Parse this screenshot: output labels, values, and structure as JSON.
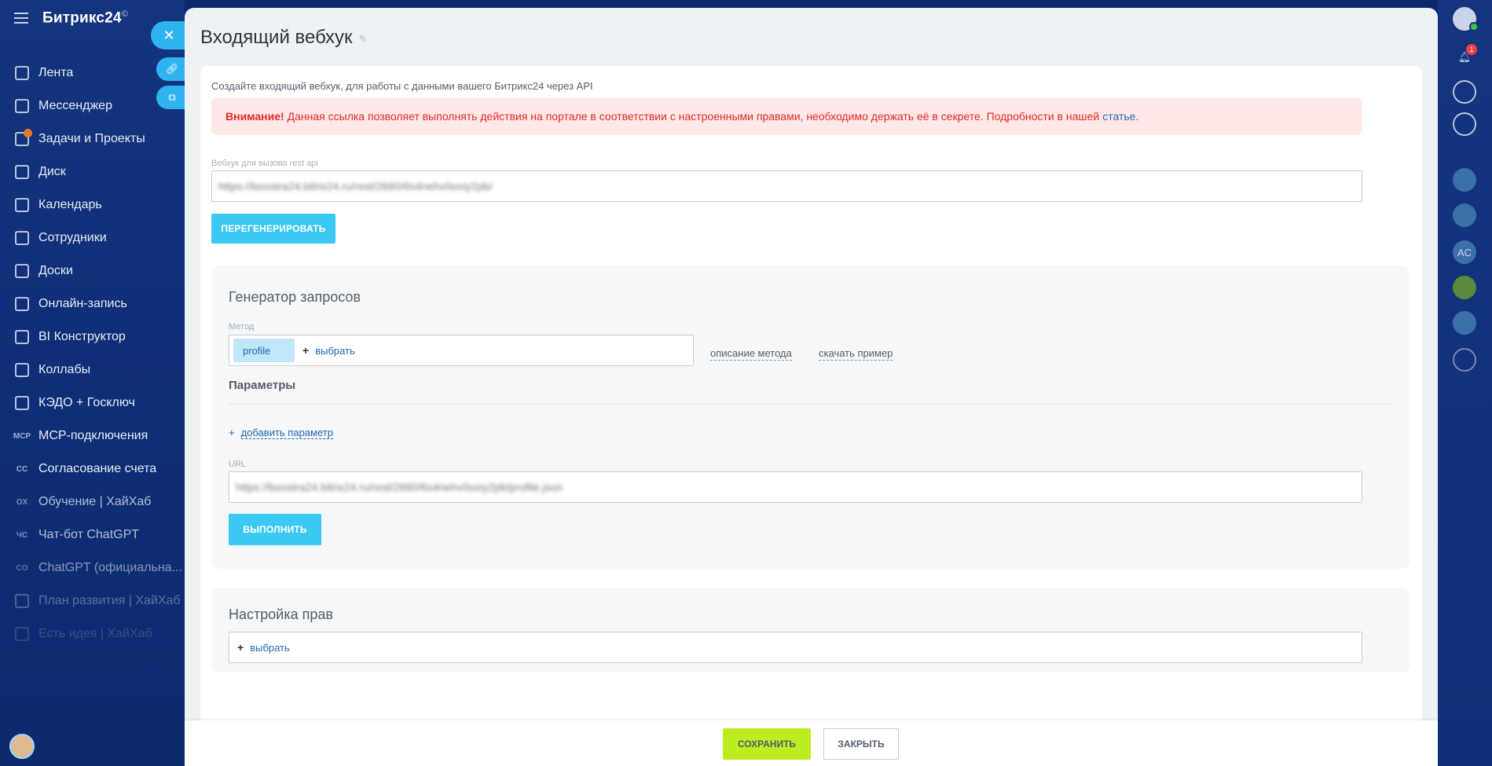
{
  "sidebar": {
    "brand": "Битрикс24",
    "brand_mark": "©",
    "items": [
      {
        "label": "Лента",
        "icon": "feed-icon"
      },
      {
        "label": "Мессенджер",
        "icon": "messenger-icon"
      },
      {
        "label": "Задачи и Проекты",
        "icon": "tasks-icon",
        "badge": true
      },
      {
        "label": "Диск",
        "icon": "disk-icon"
      },
      {
        "label": "Календарь",
        "icon": "calendar-icon"
      },
      {
        "label": "Сотрудники",
        "icon": "employees-icon"
      },
      {
        "label": "Доски",
        "icon": "boards-icon"
      },
      {
        "label": "Онлайн-запись",
        "icon": "booking-icon"
      },
      {
        "label": "BI Конструктор",
        "icon": "bi-icon"
      },
      {
        "label": "Коллабы",
        "icon": "collab-icon"
      },
      {
        "label": "КЭДО + Госключ",
        "icon": "kedo-icon"
      },
      {
        "label": "MCP-подключения",
        "icon": "mcp-icon",
        "icon_text": "MCP"
      },
      {
        "label": "Согласование счета",
        "icon": "cc-icon",
        "icon_text": "CC"
      },
      {
        "label": "Обучение | ХайХаб",
        "icon": "ox-icon",
        "icon_text": "OX"
      },
      {
        "label": "Чат-бот ChatGPT",
        "icon": "chatbot-icon",
        "icon_text": "ЧС"
      },
      {
        "label": "ChatGPT (официальна...",
        "icon": "chatgpt-icon",
        "icon_text": "CO"
      },
      {
        "label": "План развития | ХайХаб",
        "icon": "plan-icon"
      },
      {
        "label": "Есть идея | ХайХаб",
        "icon": "idea-icon"
      }
    ]
  },
  "panel": {
    "title": "Входящий вебхук",
    "intro": "Создайте входящий вебхук, для работы с данными вашего Битрикс24 через API",
    "alert": {
      "strong": "Внимание!",
      "text": "Данная ссылка позволяет выполнять действия на портале в соответствии с настроенными правами, необходимо держать её в секрете. Подробности в нашей",
      "link": "статье."
    },
    "webhook_label": "Вебхук для вызова rest api",
    "webhook_value": "https://boostra24.bitrix24.ru/rest/2660/6s4nehv0oxiy2pb/",
    "regen_button": "ПЕРЕГЕНЕРИРОВАТЬ",
    "generator": {
      "title": "Генератор запросов",
      "method_label": "Метод",
      "method_value": "profile",
      "select_label": "выбрать",
      "describe_link": "описание метода",
      "download_link": "скачать пример",
      "params_title": "Параметры",
      "add_param": "добавить параметр",
      "url_label": "URL",
      "url_value": "https://boostra24.bitrix24.ru/rest/2660/6s4nehv0oxiy2pb/profile.json",
      "run_button": "ВЫПОЛНИТЬ"
    },
    "rights": {
      "title": "Настройка прав",
      "select_label": "выбрать"
    }
  },
  "footer": {
    "save": "СОХРАНИТЬ",
    "close": "ЗАКРЫТЬ"
  },
  "rail": {
    "notification_count": "1",
    "ac_label": "AC"
  }
}
